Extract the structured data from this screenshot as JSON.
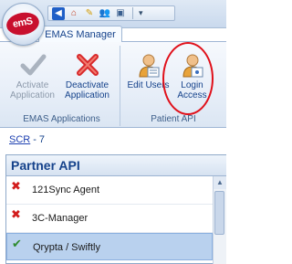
{
  "app": {
    "logo_text": "emS"
  },
  "quick_access": {
    "items": [
      {
        "name": "back-icon",
        "glyph": "◀"
      },
      {
        "name": "home-icon",
        "glyph": "⌂"
      },
      {
        "name": "edit-icon",
        "glyph": "✎"
      },
      {
        "name": "users-icon",
        "glyph": "👥"
      },
      {
        "name": "screen-icon",
        "glyph": "▣"
      }
    ],
    "more_glyph": "▾"
  },
  "ribbon": {
    "tab_label": "EMAS Manager",
    "groups": [
      {
        "label": "EMAS Applications",
        "buttons": [
          {
            "label": "Activate Application",
            "icon": "check-icon",
            "enabled": false
          },
          {
            "label": "Deactivate Application",
            "icon": "x-icon",
            "enabled": true
          }
        ]
      },
      {
        "label": "Patient API",
        "buttons": [
          {
            "label": "Edit Users",
            "icon": "user-icon",
            "enabled": true
          },
          {
            "label": "Login Access",
            "icon": "user-icon",
            "enabled": true
          }
        ]
      }
    ]
  },
  "breadcrumb": {
    "link": "SCR",
    "separator": "-",
    "count": "7"
  },
  "panel": {
    "title": "Partner API",
    "rows": [
      {
        "name": "121Sync Agent",
        "status": "x",
        "selected": false
      },
      {
        "name": "3C-Manager",
        "status": "x",
        "selected": false
      },
      {
        "name": "Qrypta / Swiftly",
        "status": "ok",
        "selected": true
      }
    ]
  },
  "colors": {
    "accent": "#15428b",
    "highlight_circle": "#e0101a",
    "status_x": "#d21c1c",
    "status_ok": "#2e8b2e",
    "selected_row": "#b9d1ee"
  }
}
